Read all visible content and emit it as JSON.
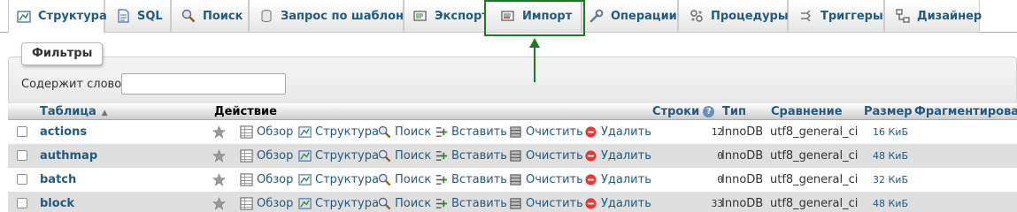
{
  "tabs": [
    {
      "label": "Структура",
      "icon": "structure-icon",
      "active": true
    },
    {
      "label": "SQL",
      "icon": "sql-icon"
    },
    {
      "label": "Поиск",
      "icon": "search-icon"
    },
    {
      "label": "Запрос по шаблону",
      "icon": "query-icon"
    },
    {
      "label": "Экспорт",
      "icon": "export-icon"
    },
    {
      "label": "Импорт",
      "icon": "import-icon"
    },
    {
      "label": "Операции",
      "icon": "wrench-icon"
    },
    {
      "label": "Процедуры",
      "icon": "routines-icon"
    },
    {
      "label": "Триггеры",
      "icon": "triggers-icon"
    },
    {
      "label": "Дизайнер",
      "icon": "designer-icon"
    }
  ],
  "filters": {
    "legend": "Фильтры",
    "label": "Содержит слово:",
    "value": ""
  },
  "table": {
    "headers": {
      "table": "Таблица",
      "sort_indicator": "▲",
      "action": "Действие",
      "rows": "Строки",
      "type": "Тип",
      "collation": "Сравнение",
      "size": "Размер",
      "overhead": "Фрагментировано"
    },
    "action_labels": {
      "browse": "Обзор",
      "structure": "Структура",
      "search": "Поиск",
      "insert": "Вставить",
      "empty": "Очистить",
      "drop": "Удалить"
    },
    "rows": [
      {
        "name": "actions",
        "rows": "12",
        "type": "InnoDB",
        "collation": "utf8_general_ci",
        "size": "16  КиБ"
      },
      {
        "name": "authmap",
        "rows": "0",
        "type": "InnoDB",
        "collation": "utf8_general_ci",
        "size": "48  КиБ"
      },
      {
        "name": "batch",
        "rows": "0",
        "type": "InnoDB",
        "collation": "utf8_general_ci",
        "size": "32  КиБ"
      },
      {
        "name": "block",
        "rows": "33",
        "type": "InnoDB",
        "collation": "utf8_general_ci",
        "size": "48  КиБ"
      }
    ]
  },
  "colors": {
    "link": "#235a81",
    "highlight": "#1e7a1e",
    "row_alt": "#dfdfdf"
  }
}
